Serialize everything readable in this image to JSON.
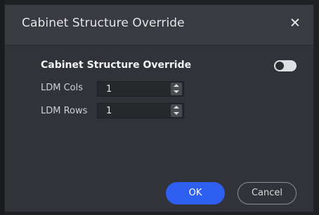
{
  "dialog": {
    "title": "Cabinet Structure Override",
    "close_glyph": "✕",
    "close_icon": "close-icon"
  },
  "section": {
    "title": "Cabinet Structure Override",
    "toggle_on": false
  },
  "fields": {
    "cols": {
      "label": "LDM Cols",
      "value": "1"
    },
    "rows": {
      "label": "LDM Rows",
      "value": "1"
    }
  },
  "buttons": {
    "ok_label": "OK",
    "cancel_label": "Cancel"
  },
  "colors": {
    "accent": "#2f5ff0",
    "background": "#323338"
  }
}
